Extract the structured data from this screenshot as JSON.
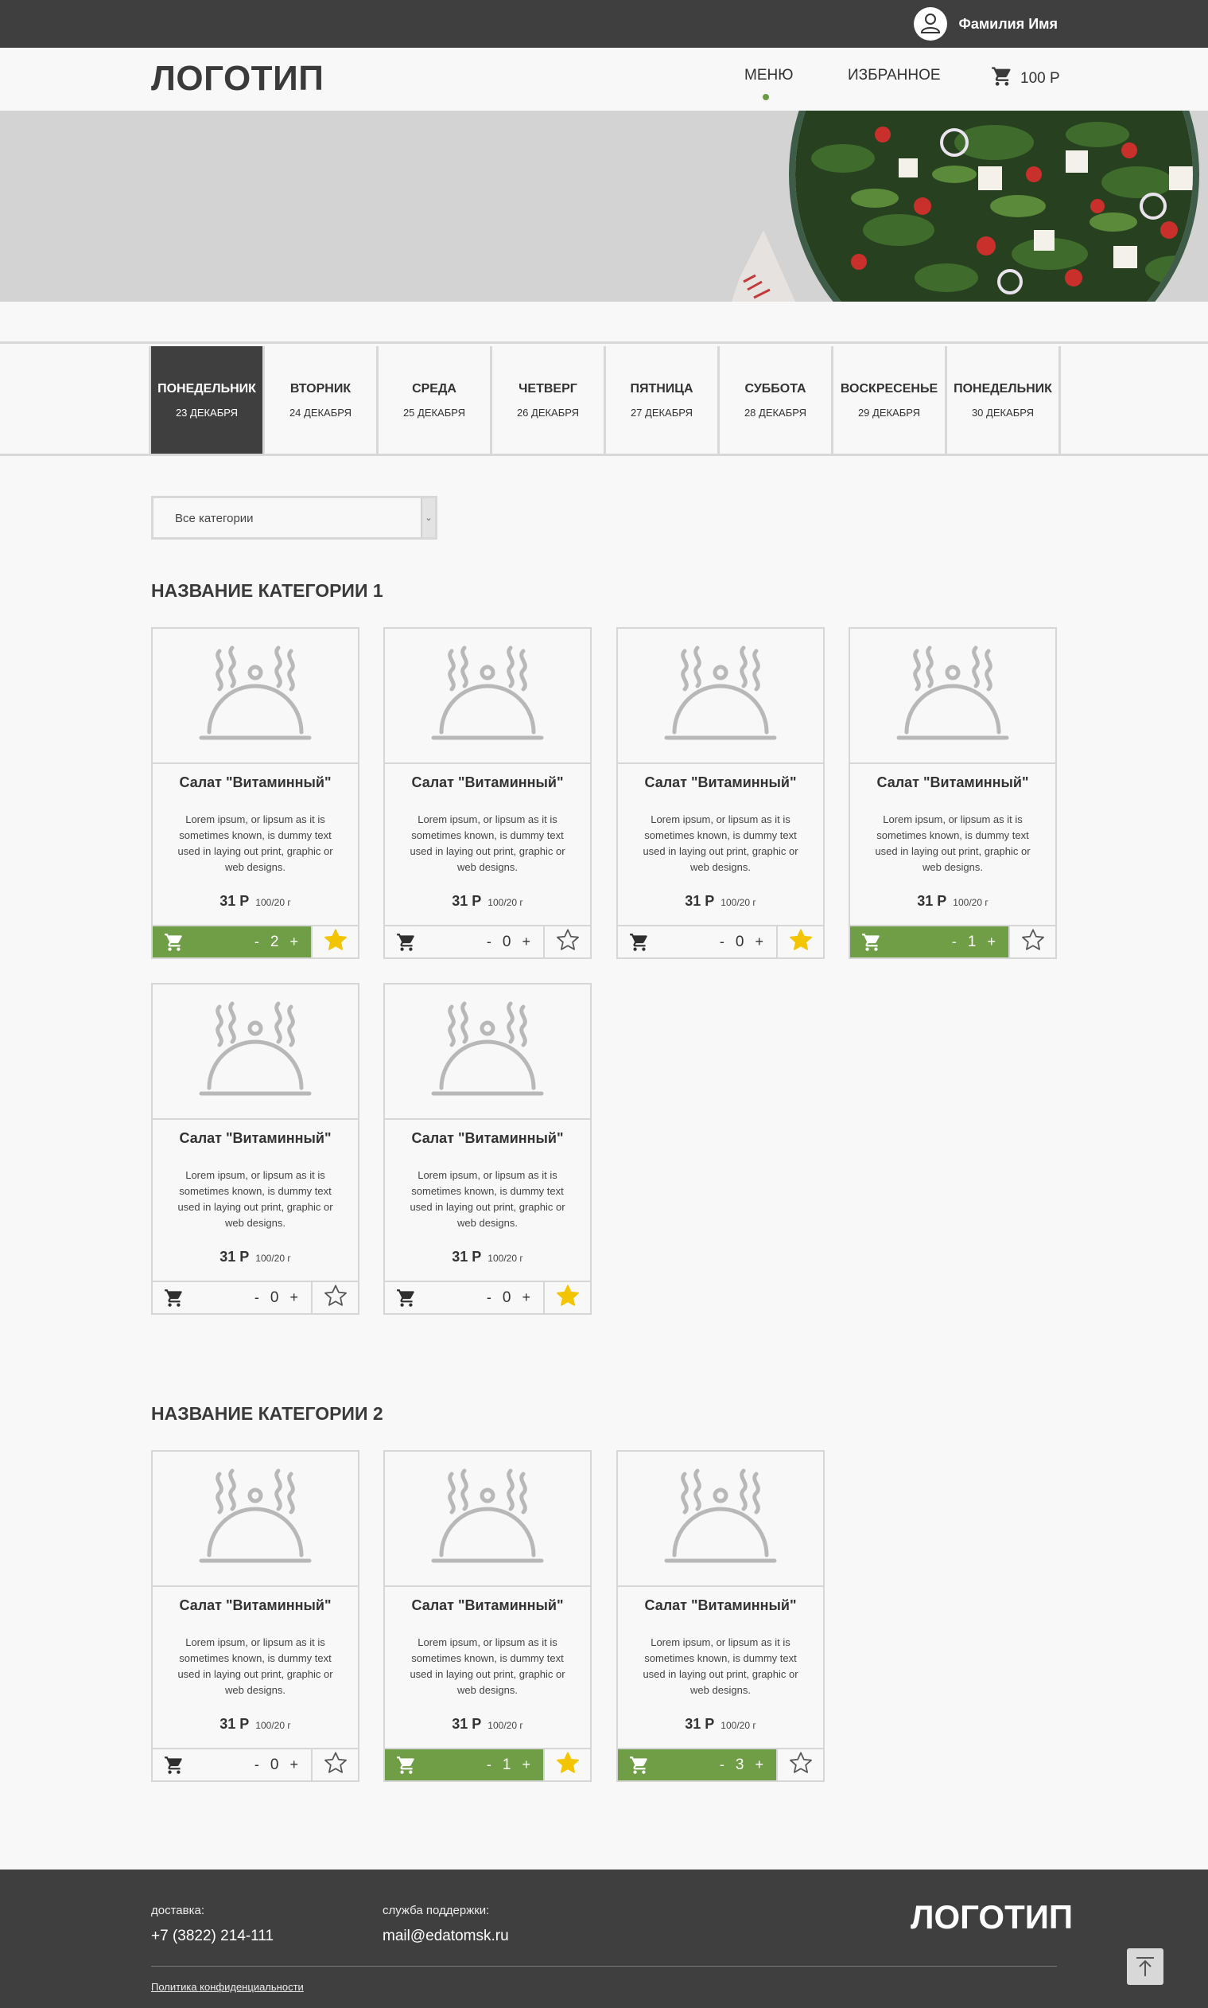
{
  "topbar": {
    "user_name": "Фамилия Имя"
  },
  "header": {
    "logo": "ЛОГОТИП",
    "nav": {
      "menu": "МЕНЮ",
      "favorites": "ИЗБРАННОЕ"
    },
    "cart_amount": "100 Р"
  },
  "days": [
    {
      "name": "ПОНЕДЕЛЬНИК",
      "date": "23 ДЕКАБРЯ",
      "active": true
    },
    {
      "name": "ВТОРНИК",
      "date": "24 ДЕКАБРЯ",
      "active": false
    },
    {
      "name": "СРЕДА",
      "date": "25 ДЕКАБРЯ",
      "active": false
    },
    {
      "name": "ЧЕТВЕРГ",
      "date": "26 ДЕКАБРЯ",
      "active": false
    },
    {
      "name": "ПЯТНИЦА",
      "date": "27 ДЕКАБРЯ",
      "active": false
    },
    {
      "name": "СУББОТА",
      "date": "28 ДЕКАБРЯ",
      "active": false
    },
    {
      "name": "ВОСКРЕСЕНЬЕ",
      "date": "29 ДЕКАБРЯ",
      "active": false
    },
    {
      "name": "ПОНЕДЕЛЬНИК",
      "date": "30 ДЕКАБРЯ",
      "active": false
    }
  ],
  "filter": {
    "selected": "Все категории"
  },
  "categories": [
    {
      "title": "НАЗВАНИЕ КАТЕГОРИИ 1",
      "items": [
        {
          "title": "Салат \"Витаминный\"",
          "desc": "Lorem ipsum, or lipsum as it is sometimes known, is dummy text used in laying out print, graphic or web designs.",
          "price": "31 Р",
          "weight": "100/20 г",
          "minus": "-",
          "qty": "2",
          "plus": "+",
          "in_cart": true,
          "favorite": true
        },
        {
          "title": "Салат \"Витаминный\"",
          "desc": "Lorem ipsum, or lipsum as it is sometimes known, is dummy text used in laying out print, graphic or web designs.",
          "price": "31 Р",
          "weight": "100/20 г",
          "minus": "-",
          "qty": "0",
          "plus": "+",
          "in_cart": false,
          "favorite": false
        },
        {
          "title": "Салат \"Витаминный\"",
          "desc": "Lorem ipsum, or lipsum as it is sometimes known, is dummy text used in laying out print, graphic or web designs.",
          "price": "31 Р",
          "weight": "100/20 г",
          "minus": "-",
          "qty": "0",
          "plus": "+",
          "in_cart": false,
          "favorite": true
        },
        {
          "title": "Салат \"Витаминный\"",
          "desc": "Lorem ipsum, or lipsum as it is sometimes known, is dummy text used in laying out print, graphic or web designs.",
          "price": "31 Р",
          "weight": "100/20 г",
          "minus": "-",
          "qty": "1",
          "plus": "+",
          "in_cart": true,
          "favorite": false
        },
        {
          "title": "Салат \"Витаминный\"",
          "desc": "Lorem ipsum, or lipsum as it is sometimes known, is dummy text used in laying out print, graphic or web designs.",
          "price": "31 Р",
          "weight": "100/20 г",
          "minus": "-",
          "qty": "0",
          "plus": "+",
          "in_cart": false,
          "favorite": false
        },
        {
          "title": "Салат \"Витаминный\"",
          "desc": "Lorem ipsum, or lipsum as it is sometimes known, is dummy text used in laying out print, graphic or web designs.",
          "price": "31 Р",
          "weight": "100/20 г",
          "minus": "-",
          "qty": "0",
          "plus": "+",
          "in_cart": false,
          "favorite": true
        }
      ]
    },
    {
      "title": "НАЗВАНИЕ КАТЕГОРИИ 2",
      "items": [
        {
          "title": "Салат \"Витаминный\"",
          "desc": "Lorem ipsum, or lipsum as it is sometimes known, is dummy text used in laying out print, graphic or web designs.",
          "price": "31 Р",
          "weight": "100/20 г",
          "minus": "-",
          "qty": "0",
          "plus": "+",
          "in_cart": false,
          "favorite": false
        },
        {
          "title": "Салат \"Витаминный\"",
          "desc": "Lorem ipsum, or lipsum as it is sometimes known, is dummy text used in laying out print, graphic or web designs.",
          "price": "31 Р",
          "weight": "100/20 г",
          "minus": "-",
          "qty": "1",
          "plus": "+",
          "in_cart": true,
          "favorite": true
        },
        {
          "title": "Салат \"Витаминный\"",
          "desc": "Lorem ipsum, or lipsum as it is sometimes known, is dummy text used in laying out print, graphic or web designs.",
          "price": "31 Р",
          "weight": "100/20 г",
          "minus": "-",
          "qty": "3",
          "plus": "+",
          "in_cart": true,
          "favorite": false
        }
      ]
    }
  ],
  "footer": {
    "delivery_label": "доставка:",
    "delivery_phone": "+7 (3822) 214-111",
    "support_label": "служба поддержки:",
    "support_email": "mail@edatomsk.ru",
    "logo": "ЛОГОТИП",
    "policy": "Политика конфиденциальности"
  },
  "colors": {
    "accent_green": "#6f9e47",
    "star_yellow": "#f2c500",
    "dark": "#3f3f3f"
  },
  "icons": [
    "user-icon",
    "cart-icon",
    "cloche-icon",
    "star-icon",
    "arrow-up-icon",
    "chevron-down-icon"
  ]
}
